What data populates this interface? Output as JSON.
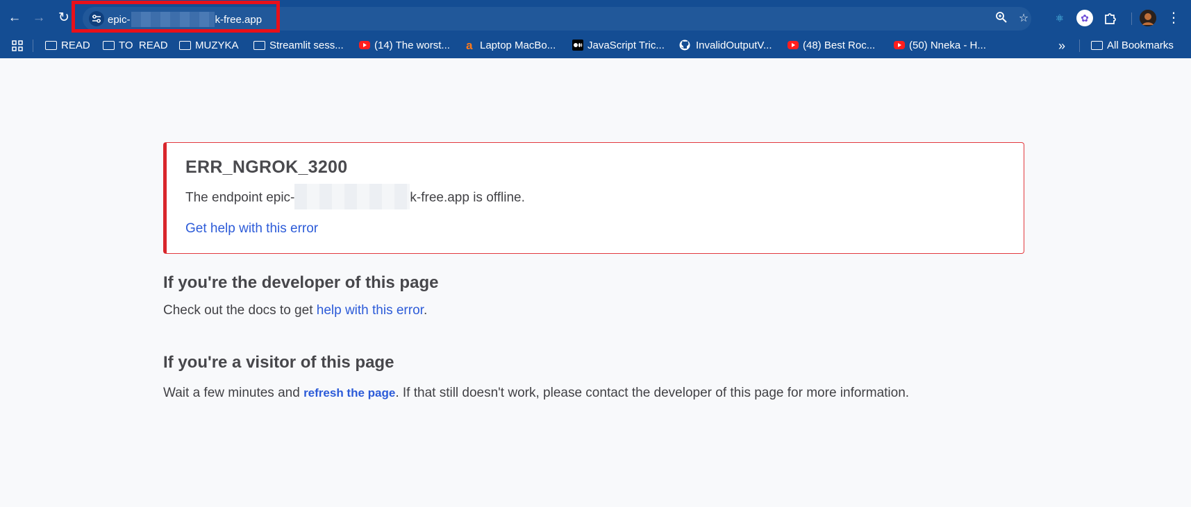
{
  "browser": {
    "nav": {
      "back_icon": "arrow-left-icon",
      "forward_icon": "arrow-right-icon",
      "reload_icon": "reload-icon"
    },
    "omnibox": {
      "url_prefix": "epic-",
      "url_suffix": "k-free.app",
      "site_info_icon": "tune-icon",
      "zoom_icon": "zoom-icon",
      "bookmark_icon": "star-icon"
    },
    "extensions": [
      "react-devtools-icon",
      "extension-badge-icon",
      "puzzle-icon",
      "avatar",
      "more-vert-icon"
    ],
    "highlight_color": "#e8101a"
  },
  "bookmarks": {
    "apps_icon": "apps-grid-icon",
    "items": [
      {
        "label": "READ",
        "icon": "folder-icon"
      },
      {
        "label": "TO  READ",
        "icon": "folder-icon"
      },
      {
        "label": "MUZYKA",
        "icon": "folder-icon"
      },
      {
        "label": "Streamlit sess...",
        "icon": "folder-icon"
      },
      {
        "label": "(14) The worst...",
        "icon": "youtube-icon"
      },
      {
        "label": "Laptop MacBo...",
        "icon": "allegro-icon"
      },
      {
        "label": "JavaScript Tric...",
        "icon": "medium-icon"
      },
      {
        "label": "InvalidOutputV...",
        "icon": "github-icon"
      },
      {
        "label": "(48) Best Roc...",
        "icon": "youtube-icon"
      },
      {
        "label": "(50) Nneka - H...",
        "icon": "youtube-icon"
      }
    ],
    "overflow_label": "»",
    "all_bookmarks": "All Bookmarks"
  },
  "error": {
    "code": "ERR_NGROK_3200",
    "message_prefix": "The endpoint epic-",
    "message_suffix": "k-free.app is offline.",
    "help_link": "Get help with this error",
    "border_color": "#d9262c"
  },
  "developer": {
    "heading": "If you're the developer of this page",
    "text_prefix": "Check out the docs to get ",
    "link": "help with this error",
    "text_suffix": "."
  },
  "visitor": {
    "heading": "If you're a visitor of this page",
    "text_prefix": "Wait a few minutes and ",
    "link": "refresh the page",
    "text_suffix": ". If that still doesn't work, please contact the developer of this page for more information."
  },
  "colors": {
    "chrome": "#144d93",
    "link": "#2c5bd8",
    "page_bg": "#f8f9fb"
  }
}
